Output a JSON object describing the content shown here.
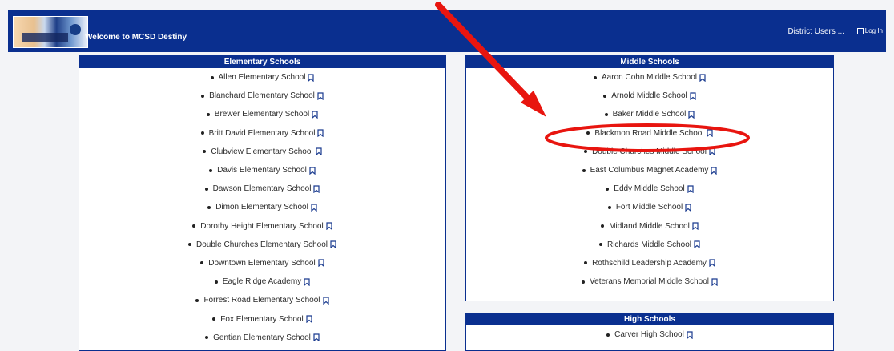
{
  "header": {
    "welcome_text": "Welcome to MCSD Destiny",
    "user_text": "District Users ...",
    "login_text": "Log In",
    "background_color": "#0a2f8f"
  },
  "panels": {
    "elementary": {
      "title": "Elementary Schools",
      "schools": [
        "Allen Elementary School",
        "Blanchard Elementary School",
        "Brewer Elementary School",
        "Britt David Elementary School",
        "Clubview Elementary School",
        "Davis Elementary School",
        "Dawson Elementary School",
        "Dimon Elementary School",
        "Dorothy Height Elementary School",
        "Double Churches Elementary School",
        "Downtown Elementary School",
        "Eagle Ridge Academy",
        "Forrest Road Elementary School",
        "Fox Elementary School",
        "Gentian Elementary School"
      ]
    },
    "middle": {
      "title": "Middle Schools",
      "schools": [
        "Aaron Cohn Middle School",
        "Arnold Middle School",
        "Baker Middle School",
        "Blackmon Road Middle School",
        "Double Churches Middle School",
        "East Columbus Magnet Academy",
        "Eddy Middle School",
        "Fort Middle School",
        "Midland Middle School",
        "Richards Middle School",
        "Rothschild Leadership Academy",
        "Veterans Memorial Middle School"
      ]
    },
    "high": {
      "title": "High Schools",
      "schools": [
        "Carver High School"
      ]
    }
  },
  "icons": {
    "bookmark": "bookmark-icon",
    "login": "login-icon"
  },
  "annotation": {
    "arrow_color": "#e8150f",
    "highlighted_school": "Blackmon Road Middle School"
  }
}
